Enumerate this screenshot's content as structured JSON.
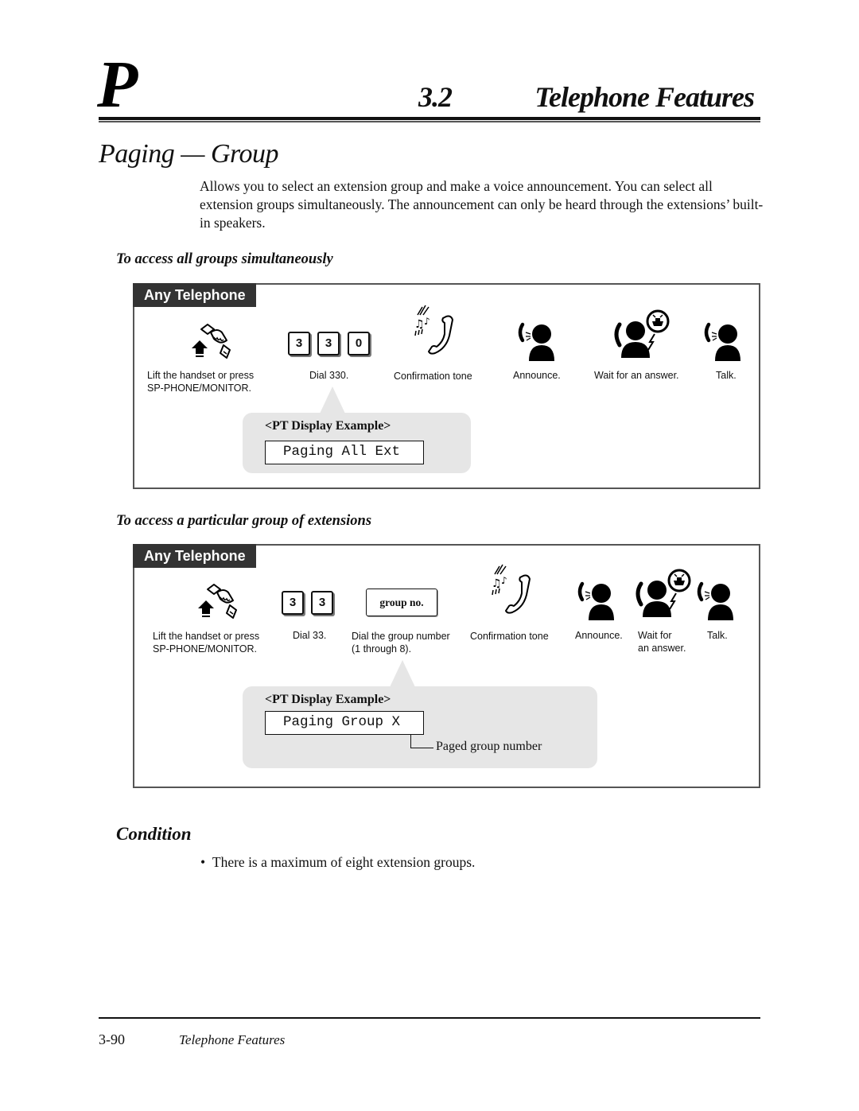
{
  "header": {
    "section_letter": "P",
    "section_number": "3.2",
    "section_title": "Telephone Features"
  },
  "page_title": "Paging — Group",
  "intro": "Allows you to select an extension group and make a voice announcement. You can select all extension groups simultaneously. The announcement can only be heard through the extensions’ built-in speakers.",
  "procedures": [
    {
      "subheading": "To access all groups simultaneously",
      "tab_label": "Any Telephone",
      "keys": [
        "3",
        "3",
        "0"
      ],
      "steps": [
        {
          "icon": "lift-handset-icon",
          "label_line1": "Lift the handset or press",
          "label_line2": "SP-PHONE/MONITOR."
        },
        {
          "icon": "dial-keys",
          "label_line1": "Dial 330."
        },
        {
          "icon": "confirmation-tone-icon",
          "label_line1": "Confirmation tone"
        },
        {
          "icon": "announce-icon",
          "label_line1": "Announce."
        },
        {
          "icon": "wait-answer-icon",
          "label_line1": "Wait for an answer."
        },
        {
          "icon": "talk-icon",
          "label_line1": "Talk."
        }
      ],
      "display": {
        "title": "<PT Display Example>",
        "text": "Paging All Ext"
      }
    },
    {
      "subheading": "To access a particular group of extensions",
      "tab_label": "Any Telephone",
      "keys": [
        "3",
        "3"
      ],
      "group_button": "group no.",
      "steps": [
        {
          "icon": "lift-handset-icon",
          "label_line1": "Lift the handset or press",
          "label_line2": "SP-PHONE/MONITOR."
        },
        {
          "icon": "dial-keys",
          "label_line1": "Dial 33."
        },
        {
          "icon": "group-number-button",
          "label_line1": "Dial the group number",
          "label_line2": "(1 through 8)."
        },
        {
          "icon": "confirmation-tone-icon",
          "label_line1": "Confirmation tone"
        },
        {
          "icon": "announce-icon",
          "label_line1": "Announce."
        },
        {
          "icon": "wait-answer-icon",
          "label_line1": "Wait for",
          "label_line2": "an answer."
        },
        {
          "icon": "talk-icon",
          "label_line1": "Talk."
        }
      ],
      "display": {
        "title": "<PT Display Example>",
        "text": "Paging Group X",
        "annotation": "Paged group number"
      }
    }
  ],
  "condition": {
    "title": "Condition",
    "bullets": [
      "There is a maximum of eight extension groups."
    ]
  },
  "footer": {
    "page_number": "3-90",
    "title": "Telephone Features"
  },
  "colors": {
    "tab_background": "#333333",
    "callout_background": "#e6e6e6",
    "box_border": "#555555"
  }
}
